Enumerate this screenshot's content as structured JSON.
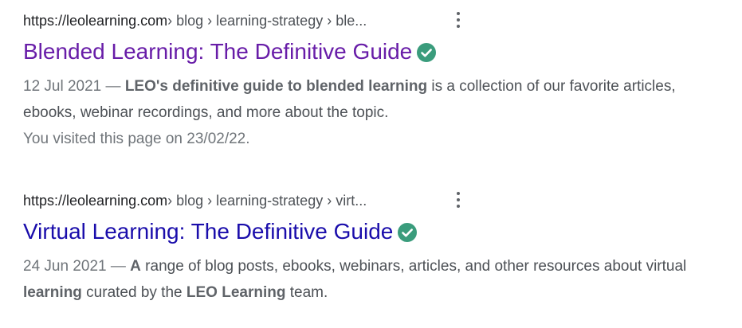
{
  "results": [
    {
      "domain": "https://leolearning.com",
      "path": " › blog › learning-strategy › ble...",
      "title": "Blended Learning: The Definitive Guide",
      "date": "12 Jul 2021",
      "dash": " — ",
      "snippet_bold_1": "LEO's definitive guide to blended learning",
      "snippet_text_1": " is a collection of our favorite articles, ebooks, webinar recordings, and more about the topic.",
      "visited_note": "You visited this page on 23/02/22.",
      "title_color": "#681da8"
    },
    {
      "domain": "https://leolearning.com",
      "path": " › blog › learning-strategy › virt...",
      "title": "Virtual Learning: The Definitive Guide",
      "date": "24 Jun 2021",
      "dash": " — ",
      "snippet_bold_1": "A",
      "snippet_text_1": " range of blog posts, ebooks, webinars, articles, and other resources about virtual ",
      "snippet_bold_2": "learning",
      "snippet_text_2": " curated by the ",
      "snippet_bold_3": "LEO Learning",
      "snippet_text_3": " team.",
      "title_color": "#1a0dab"
    }
  ],
  "icons": {
    "more": "more-vert-icon",
    "verified": "verified-check-icon"
  },
  "colors": {
    "verified": "#3a9c7c",
    "visited_link": "#681da8",
    "link": "#1a0dab",
    "text": "#4d5156"
  }
}
